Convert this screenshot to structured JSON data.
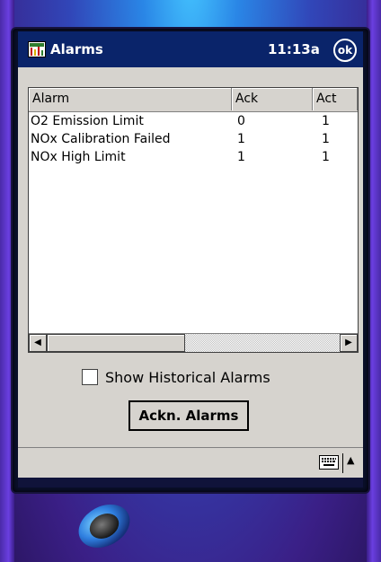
{
  "titlebar": {
    "title": "Alarms",
    "time": "11:13a",
    "ok_label": "ok"
  },
  "list": {
    "columns": [
      "Alarm",
      "Ack",
      "Act"
    ],
    "rows": [
      {
        "alarm": "O2 Emission Limit",
        "ack": "0",
        "act": "1"
      },
      {
        "alarm": "NOx Calibration Failed",
        "ack": "1",
        "act": "1"
      },
      {
        "alarm": "NOx High Limit",
        "ack": "1",
        "act": "1"
      }
    ]
  },
  "controls": {
    "show_historical_label": "Show Historical Alarms",
    "show_historical_checked": false,
    "ack_button_label": "Ackn. Alarms"
  },
  "scrollbar": {
    "left_icon": "arrow-left-icon",
    "right_icon": "arrow-right-icon"
  },
  "cmdbar": {
    "keyboard_icon": "keyboard-icon",
    "sip_icon": "sip-arrow-up-icon"
  },
  "colors": {
    "titlebar": "#0a246a",
    "window": "#d6d3ce",
    "device_accent": "#3146b8"
  }
}
